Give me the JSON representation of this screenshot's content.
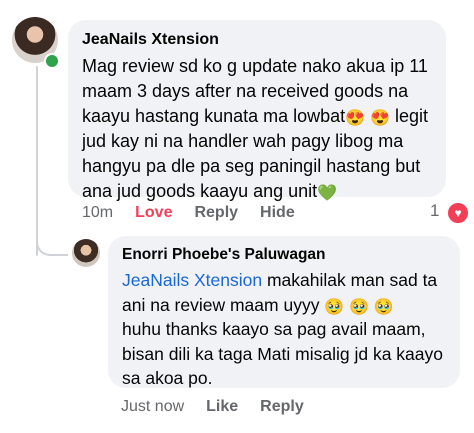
{
  "comment": {
    "author": "JeaNails Xtension",
    "text_parts": [
      "Mag review sd ko g update nako akua ip 11 maam 3 days after na received goods na kaayu hastang kunata ma lowbat",
      " legit jud kay ni na handler wah pagy libog ma hangyu pa dle pa seg paningil hastang but ana jud goods kaayu ang unit"
    ],
    "emojis": [
      "😍",
      "😍",
      "💚"
    ],
    "time": "10m",
    "love_label": "Love",
    "reply_label": "Reply",
    "hide_label": "Hide",
    "reaction_count": "1",
    "reaction_icon": "heart-icon",
    "love_color": "#f33e58"
  },
  "reply": {
    "author": "Enorri Phoebe's Paluwagan",
    "mention": "JeaNails Xtension",
    "text_parts": [
      " makahilak man sad ta ani na review maam uyyy",
      "huhu thanks kaayo sa pag avail maam, bisan dili ka taga Mati misalig jd ka kaayo sa akoa po."
    ],
    "emojis": [
      "🥹",
      "🥹",
      "🥹"
    ],
    "time": "Just now",
    "like_label": "Like",
    "reply_label": "Reply",
    "mention_color": "#1b67d2"
  }
}
